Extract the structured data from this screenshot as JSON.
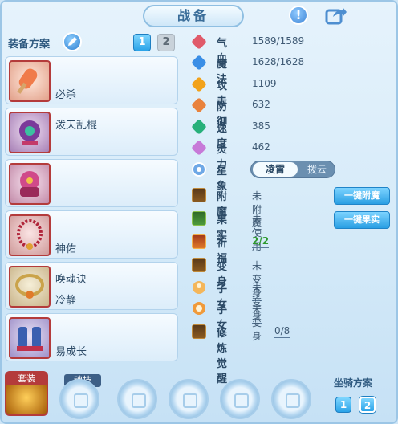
{
  "header": {
    "title": "战备"
  },
  "plan": {
    "label": "装备方案",
    "numbers": [
      "1",
      "2"
    ]
  },
  "slots": [
    {
      "line1": "必杀",
      "line2": ""
    },
    {
      "line1": "泼天乱棍",
      "line2": ""
    },
    {
      "line1": "",
      "line2": ""
    },
    {
      "line1": "",
      "line2": "神佑"
    },
    {
      "line1": "唤魂诀",
      "line2": "冷静"
    },
    {
      "line1": "",
      "line2": "易成长"
    }
  ],
  "stats": [
    {
      "label": "气血",
      "value": "1589/1589",
      "color": "#e05a6a"
    },
    {
      "label": "魔法",
      "value": "1628/1628",
      "color": "#3a8ee6"
    },
    {
      "label": "攻击",
      "value": "1109",
      "color": "#f2a21a"
    },
    {
      "label": "防御",
      "value": "632",
      "color": "#e9823c"
    },
    {
      "label": "速度",
      "value": "385",
      "color": "#27b07a"
    },
    {
      "label": "灵力",
      "value": "462",
      "color": "#c77ad8"
    }
  ],
  "star": {
    "label": "星象",
    "selected": "凌霄",
    "other": "拨云"
  },
  "extras": [
    {
      "label": "附魔",
      "value": "未附魔",
      "value_color": "#3f5a74"
    },
    {
      "label": "果实",
      "value": "未使用",
      "value_color": "#3f5a74"
    },
    {
      "label": "祈福",
      "value": "2/2",
      "value_color": "#2f9a2f"
    },
    {
      "label": "变身",
      "value": "未变身",
      "value_color": "#3f5a74"
    },
    {
      "label": "子女",
      "value": "未变身",
      "value_color": "#3f5a74"
    },
    {
      "label": "子女",
      "value": "未变身",
      "value_color": "#3f5a74"
    },
    {
      "label": "修炼觉醒",
      "value": "0/8",
      "value_color": "#3f5a74"
    }
  ],
  "buttons": {
    "enchant": "一键附魔",
    "fruit": "一键果实"
  },
  "bottom": {
    "suit_label": "套装",
    "soul_label": "魂技",
    "mount_label": "坐骑方案",
    "mount_numbers": [
      "1",
      "2"
    ]
  }
}
